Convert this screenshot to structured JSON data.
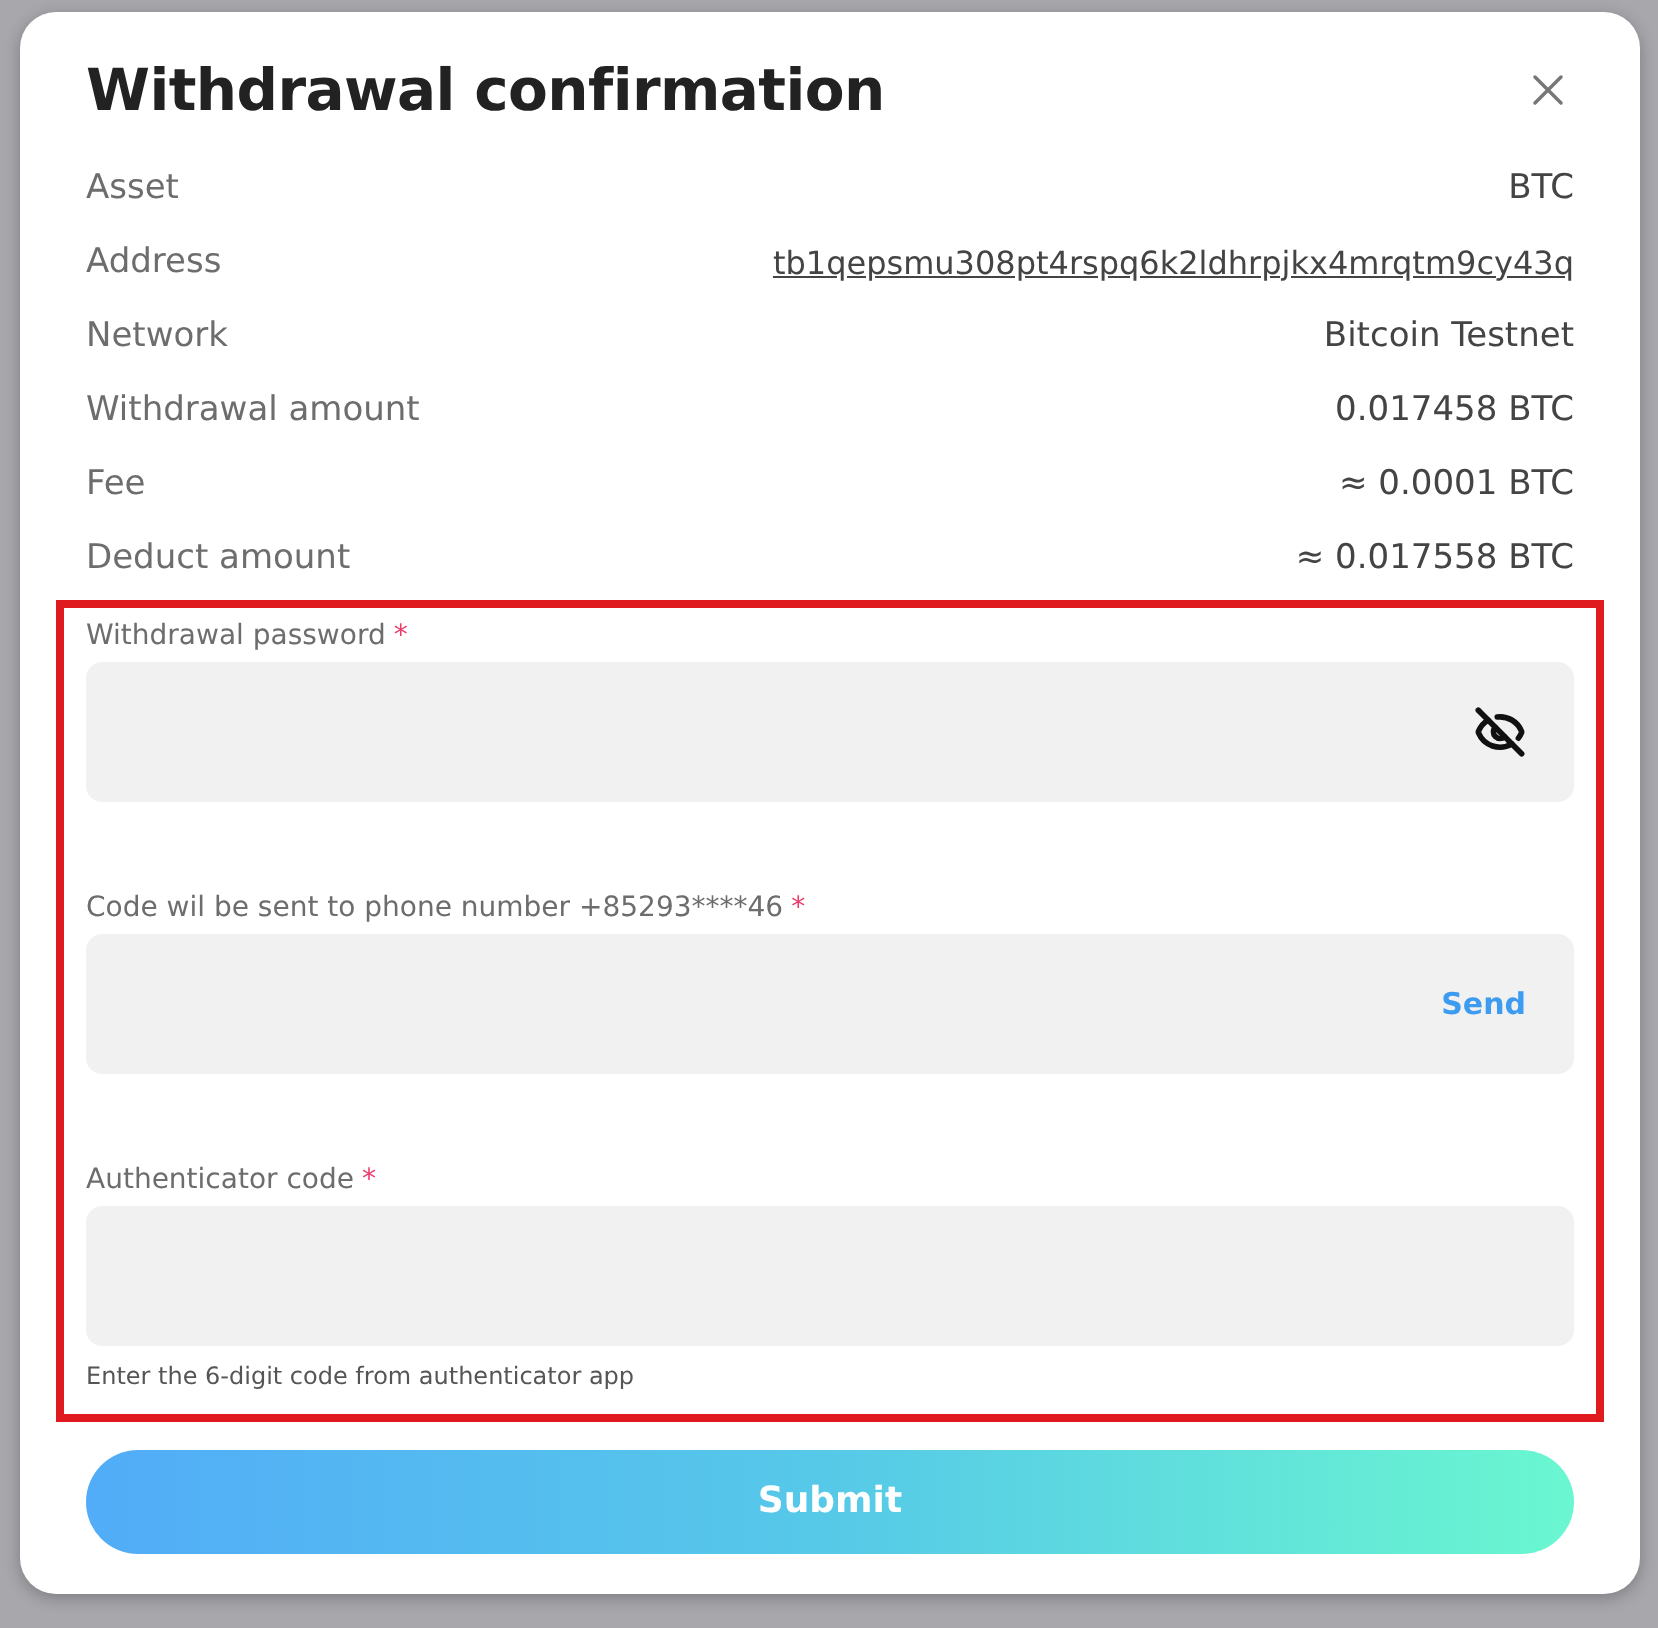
{
  "dialog": {
    "title": "Withdrawal confirmation"
  },
  "details": [
    {
      "label": "Asset",
      "value": "BTC",
      "kind": "text"
    },
    {
      "label": "Address",
      "value": "tb1qepsmu308pt4rspq6k2ldhrpjkx4mrqtm9cy43q",
      "kind": "link"
    },
    {
      "label": "Network",
      "value": "Bitcoin Testnet",
      "kind": "text"
    },
    {
      "label": "Withdrawal amount",
      "value": "0.017458 BTC",
      "kind": "text"
    },
    {
      "label": "Fee",
      "value": "≈ 0.0001 BTC",
      "kind": "text"
    },
    {
      "label": "Deduct amount",
      "value": "≈ 0.017558 BTC",
      "kind": "text"
    }
  ],
  "fields": [
    {
      "label": "Withdrawal password",
      "required_mark": "*",
      "kind": "password"
    },
    {
      "label": "Code wil be sent to phone number +85293****46",
      "required_mark": "*",
      "kind": "send",
      "action": "Send"
    },
    {
      "label": "Authenticator code",
      "required_mark": "*",
      "kind": "plain",
      "hint": "Enter the 6-digit code from authenticator app"
    }
  ],
  "submit": "Submit"
}
